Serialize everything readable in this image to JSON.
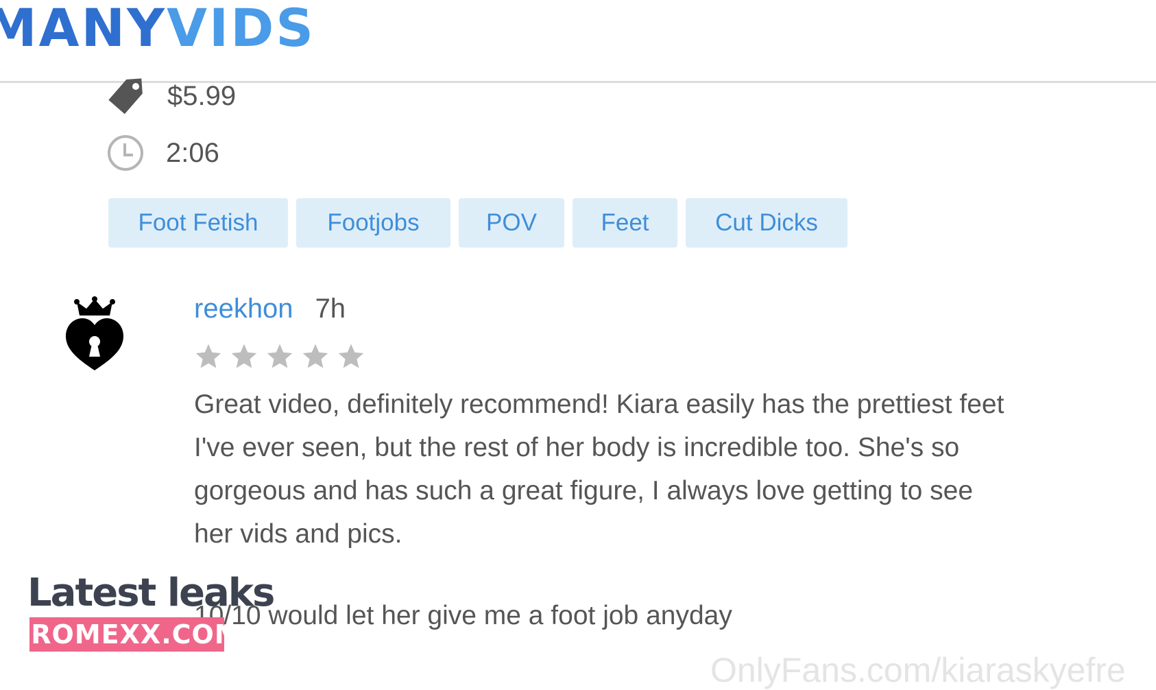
{
  "header": {
    "logo_part1": "MANY",
    "logo_part2": "VIDS"
  },
  "video": {
    "price": "$5.99",
    "duration": "2:06"
  },
  "tags": [
    "Foot Fetish",
    "Footjobs",
    "POV",
    "Feet",
    "Cut Dicks"
  ],
  "review": {
    "username": "reekhon",
    "age": "7h",
    "rating": 0,
    "rating_max": 5,
    "text": "Great video, definitely recommend! Kiara easily has the prettiest feet I've ever seen, but the rest of her body is incredible too. She's so gorgeous and has such a great figure, I always love getting to see her vids and pics.",
    "followup": "10/10 would let her give me a foot job anyday"
  },
  "watermarks": {
    "badge_title": "Latest leaks",
    "badge_site": "EROMEXX.COM",
    "source": "OnlyFans.com/kiaraskyefre"
  },
  "icons": {
    "price": "price-tag-icon",
    "duration": "clock-icon",
    "avatar": "crowned-heart-keyhole-icon",
    "rating": "star-icon"
  },
  "colors": {
    "accent": "#3f8ed9",
    "logo_dark": "#2f6fcf",
    "logo_light": "#4a9be8",
    "tag_bg": "#deeef9",
    "star_empty": "#bdbdbd",
    "badge_pink": "#f0668a"
  }
}
